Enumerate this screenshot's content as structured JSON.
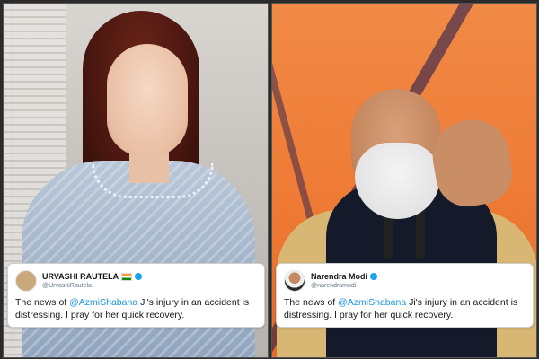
{
  "left_tweet": {
    "name": "URVASHI RAUTELA",
    "handle": "@UrvashiRautela",
    "text_before": "The news of ",
    "mention": "@AzmiShabana",
    "text_after": " Ji's injury in an accident is distressing. I pray for her quick recovery."
  },
  "right_tweet": {
    "name": "Narendra Modi",
    "handle": "@narendramodi",
    "text_before": "The news of ",
    "mention": "@AzmiShabana",
    "text_after": " Ji's injury in an accident is distressing. I pray for her quick recovery."
  },
  "colors": {
    "mention": "#1b95e0",
    "verified": "#1da1f2",
    "card_bg": "#ffffff"
  },
  "icons": [
    "verified-badge-icon",
    "india-flag-icon"
  ]
}
